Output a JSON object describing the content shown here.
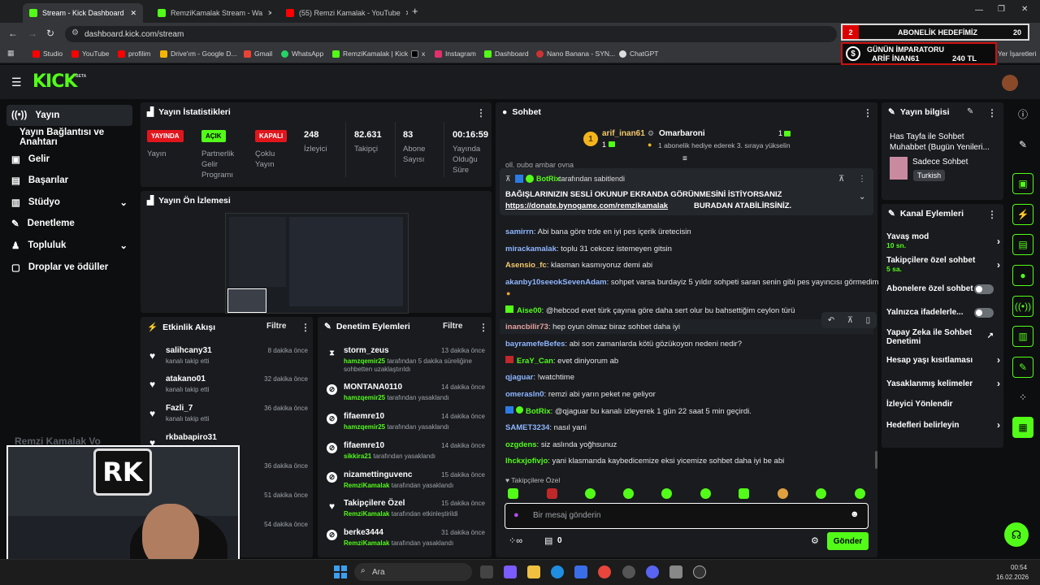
{
  "browser": {
    "tabs": [
      {
        "title": "Stream - Kick Dashboard",
        "icon": "kick-icon"
      },
      {
        "title": "RemziKamalak Stream - Wa",
        "icon": "kick-icon"
      },
      {
        "title": "(55) Remzi Kamalak - YouTube",
        "icon": "youtube-icon"
      }
    ],
    "url": "dashboard.kick.com/stream",
    "bookmarks": [
      "Studio",
      "YouTube",
      "profilim",
      "Drive'ım - Google D...",
      "Gmail",
      "WhatsApp",
      "RemziKamalak | Kick",
      "x",
      "Instagram",
      "Dashboard",
      "Nano Banana - SYN...",
      "ChatGPT"
    ],
    "bookmarks_right": "Yer İşaretleri"
  },
  "overlay": {
    "goal_count": "2",
    "goal_label": "ABONELİK HEDEFİMİZ",
    "goal_target": "20",
    "emperor_title": "GÜNÜN İMPARATORU",
    "emperor_name": "ARİF İNAN61",
    "emperor_amount": "240 TL",
    "channel_watermark": "Remzi Kamalak Vo"
  },
  "logo": "KICK",
  "logo_beta": "BETA",
  "sidebar": [
    {
      "label": "Yayın",
      "icon": "broadcast-icon"
    },
    {
      "label": "Yayın Bağlantısı ve Anahtarı",
      "icon": ""
    },
    {
      "label": "Gelir",
      "icon": "money-icon"
    },
    {
      "label": "Başarılar",
      "icon": "trophy-icon"
    },
    {
      "label": "Stüdyo",
      "icon": "studio-icon"
    },
    {
      "label": "Denetleme",
      "icon": "wrench-icon"
    },
    {
      "label": "Topluluk",
      "icon": "people-icon"
    },
    {
      "label": "Droplar ve ödüller",
      "icon": "gift-icon"
    }
  ],
  "stats": {
    "title": "Yayın İstatistikleri",
    "live_badge": "YAYINDA",
    "live_label": "Yayın",
    "partner_badge": "AÇIK",
    "partner_label": "Partnerlik Gelir Programı",
    "multi_badge": "KAPALI",
    "multi_label": "Çoklu Yayın",
    "viewers_value": "248",
    "viewers_label": "İzleyici",
    "followers_value": "82.631",
    "followers_label": "Takipçi",
    "subs_value": "83",
    "subs_label": "Abone Sayısı",
    "uptime_value": "00:16:59",
    "uptime_label": "Yayında Olduğu Süre"
  },
  "preview": {
    "title": "Yayın Ön İzlemesi"
  },
  "activity": {
    "title": "Etkinlik Akışı",
    "filter": "Filtre",
    "items": [
      {
        "name": "salihcany31",
        "sub": "kanalı takip etti",
        "time": "8 dakika önce"
      },
      {
        "name": "atakano01",
        "sub": "kanalı takip etti",
        "time": "32 dakika önce"
      },
      {
        "name": "Fazli_7",
        "sub": "kanalı takip etti",
        "time": "36 dakika önce"
      },
      {
        "name": "rkbabapiro31",
        "sub": "",
        "time": ""
      },
      {
        "name": "",
        "sub": "",
        "time": "36 dakika önce"
      },
      {
        "name": "",
        "sub": "",
        "time": "51 dakika önce"
      },
      {
        "name": "",
        "sub": "",
        "time": "54 dakika önce"
      }
    ]
  },
  "moderation": {
    "title": "Denetim Eylemleri",
    "filter": "Filtre",
    "items": [
      {
        "name": "storm_zeus",
        "by": "hamzqemir25",
        "text": "tarafından 5 dakika süreliğine sohbetten uzaklaştırıldı",
        "time": "13 dakika önce",
        "icon": "hourglass-icon"
      },
      {
        "name": "MONTANA0110",
        "by": "hamzqemir25",
        "text": "tarafından yasaklandı",
        "time": "14 dakika önce",
        "icon": "ban-icon"
      },
      {
        "name": "fifaemre10",
        "by": "hamzqemir25",
        "text": "tarafından yasaklandı",
        "time": "14 dakika önce",
        "icon": "ban-icon"
      },
      {
        "name": "fifaemre10",
        "by": "sikkira21",
        "text": "tarafından yasaklandı",
        "time": "14 dakika önce",
        "icon": "ban-icon"
      },
      {
        "name": "nizamettinguvenc",
        "by": "RemziKamalak",
        "text": "tarafından yasaklandı",
        "time": "15 dakika önce",
        "icon": "ban-icon"
      },
      {
        "name": "Takipçilere Özel",
        "by": "RemziKamalak",
        "text": "tarafından etkinleştirildi",
        "time": "15 dakika önce",
        "icon": "heart-icon"
      },
      {
        "name": "berke3444",
        "by": "RemziKamalak",
        "text": "tarafından yasaklandı",
        "time": "31 dakika önce",
        "icon": "ban-icon"
      }
    ]
  },
  "chat": {
    "title": "Sohbet",
    "top_gifter": {
      "rank": "1",
      "name": "arif_inan61",
      "count": "1"
    },
    "gift_user": "Omarbaroni",
    "gift_count": "1",
    "gift_text": "1 abonelik hediye ederek 3. sıraya yükselin",
    "pinned_by": "BotRix",
    "pinned_by_suffix": "tarafından sabitlendi",
    "pinned_line1": "BAĞIŞLARINIZIN SESLİ OKUNUP EKRANDA GÖRÜNMESİNİ İSTİYORSANIZ",
    "pinned_link": "https://donate.bynogame.com/remzikamalak",
    "pinned_line2": "BURADAN ATABİLİRSİNİZ.",
    "partial_top": "oll. pubg ambar oyna",
    "messages": [
      {
        "user": "samirrn",
        "color": "#8fb6ff",
        "text": "Abi bana göre trde en iyi pes içerik üretecisin"
      },
      {
        "user": "mirackamalak",
        "color": "#8fb6ff",
        "text": "toplu 31 cekcez istemeyen gitsin"
      },
      {
        "user": "Asensio_fc",
        "color": "#f5c86b",
        "text": "klasman kasmıyoruz demi abi"
      },
      {
        "user": "akanby10seeokSevenAdam",
        "color": "#8fb6ff",
        "text": "sohpet varsa burdayiz 5 yıldır sohpeti saran senin gibi pes yayıncısı görmedim"
      },
      {
        "user": "Aise00",
        "color": "#53fc18",
        "text": "@hebcod evet türk çayına göre daha sert olur bu bahsettiğim ceylon türü"
      },
      {
        "user": "inancbilir73",
        "color": "#e6a0a0",
        "text": "hep oyun olmaz biraz sohbet daha iyi"
      },
      {
        "user": "bayramefeBefes",
        "color": "#8fb6ff",
        "text": "abi son zamanlarda kötü gözükoyon nedeni nedir?"
      },
      {
        "user": "EraY_Can",
        "color": "#53fc18",
        "text": "evet diniyorum ab"
      },
      {
        "user": "qjaguar",
        "color": "#8fb6ff",
        "text": "!watchtime"
      },
      {
        "user": "omerasln0",
        "color": "#8fb6ff",
        "text": "remzi abi yarın peket ne geliyor"
      },
      {
        "user": "BotRix",
        "color": "#53fc18",
        "text": "@qjaguar bu kanalı izleyerek 1 gün 22 saat 5 min geçirdi."
      },
      {
        "user": "SAMET3234",
        "color": "#8fb6ff",
        "text": "nasıl yani"
      },
      {
        "user": "ozgdens",
        "color": "#53fc18",
        "text": "siz aslında yoğhsunuz"
      },
      {
        "user": "lhckxjofivjo",
        "color": "#53fc18",
        "text": "yani klasmanda kaybedicemize eksi yicemize sohbet daha iyi be abi"
      }
    ],
    "followers_only": "Takipçilere Özel",
    "input_placeholder": "Bir mesaj gönderin",
    "points": "0",
    "send": "Gönder"
  },
  "info": {
    "title": "Yayın bilgisi",
    "stream_title": "Has Tayfa ile Sohbet Muhabbet (Bugün Yenileri...",
    "category": "Sadece Sohbet",
    "language": "Turkish",
    "actions_title": "Kanal Eylemleri",
    "actions": [
      {
        "label": "Yavaş mod",
        "sub": "10 sn.",
        "type": "chevron"
      },
      {
        "label": "Takipçilere özel sohbet",
        "sub": "5 sa.",
        "type": "chevron"
      },
      {
        "label": "Abonelere özel sohbet",
        "sub": "",
        "type": "toggle"
      },
      {
        "label": "Yalnızca ifadelerle...",
        "sub": "",
        "type": "toggle"
      },
      {
        "label": "Yapay Zeka ile Sohbet Denetimi",
        "sub": "",
        "type": "external"
      },
      {
        "label": "Hesap yaşı kısıtlaması",
        "sub": "",
        "type": "chevron"
      },
      {
        "label": "Yasaklanmış kelimeler",
        "sub": "",
        "type": "chevron"
      },
      {
        "label": "İzleyici Yönlendir",
        "sub": "",
        "type": "none"
      },
      {
        "label": "Hedefleri belirleyin",
        "sub": "",
        "type": "chevron"
      }
    ]
  },
  "taskbar": {
    "search": "Ara",
    "time": "00:54",
    "date": "16.02.2026"
  }
}
